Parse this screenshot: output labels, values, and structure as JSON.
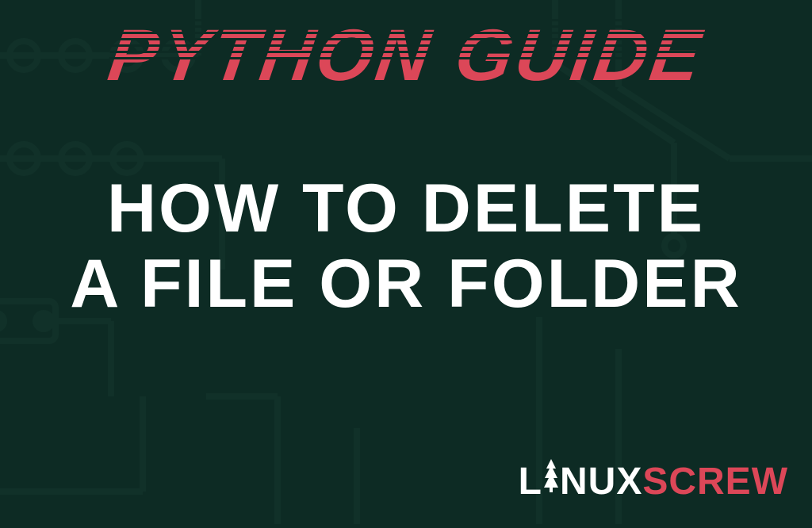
{
  "header": {
    "label": "PYTHON GUIDE"
  },
  "title": {
    "line1": "HOW TO DELETE",
    "line2": "A FILE OR FOLDER"
  },
  "logo": {
    "part1": "L",
    "part2": "NUX",
    "part3": "SCREW"
  },
  "colors": {
    "background": "#0d2b24",
    "accent": "#dc4758",
    "text": "#ffffff",
    "circuit": "#1a3f36"
  }
}
